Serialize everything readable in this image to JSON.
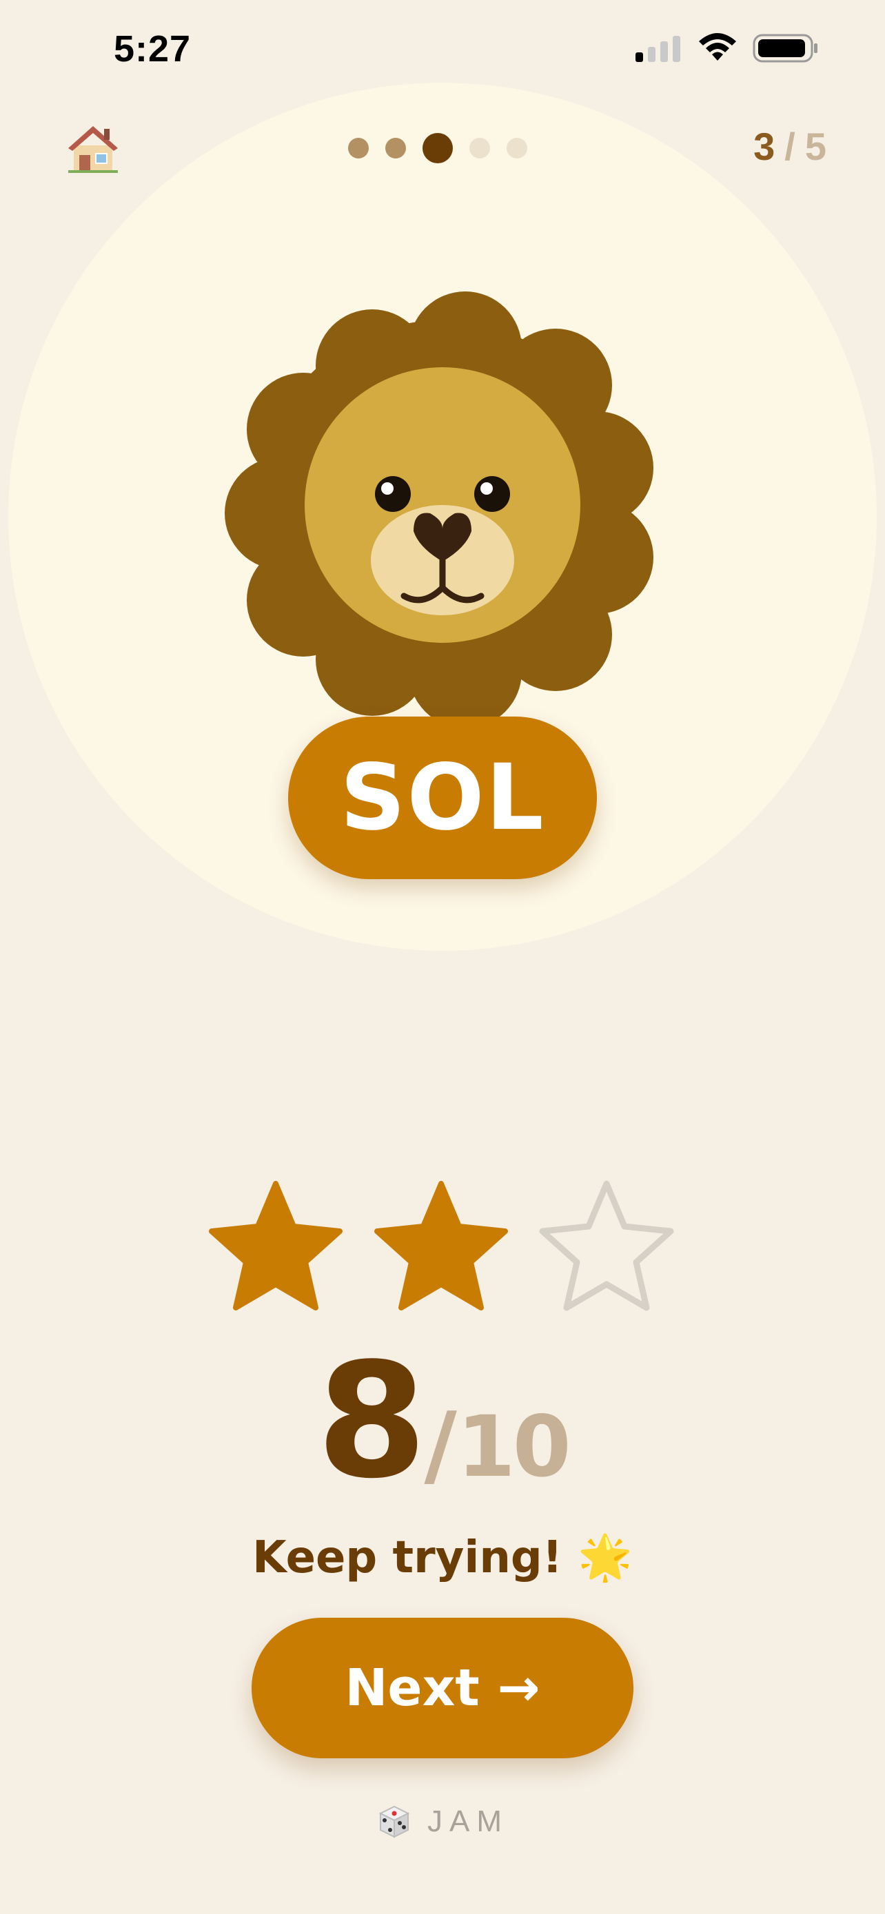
{
  "status_bar": {
    "time": "5:27"
  },
  "header": {
    "home_icon": "house-icon",
    "progress": {
      "total_steps": 5,
      "current_step": 3
    },
    "step_counter": {
      "current": "3",
      "separator": "/",
      "total": "5"
    }
  },
  "card": {
    "animal_icon": "lion-icon",
    "word": "SOL"
  },
  "result": {
    "stars_earned": 2,
    "stars_total": 3,
    "score": "8",
    "score_separator": "/",
    "score_total": "10",
    "feedback": "Keep trying! 🌟"
  },
  "actions": {
    "next_label": "Next →"
  },
  "brand": {
    "icon": "dice-icon",
    "name": "JAM"
  },
  "colors": {
    "background": "#f6efe4",
    "accent": "#c97c02",
    "text_dark": "#6b3d06",
    "muted": "#c7b196"
  }
}
